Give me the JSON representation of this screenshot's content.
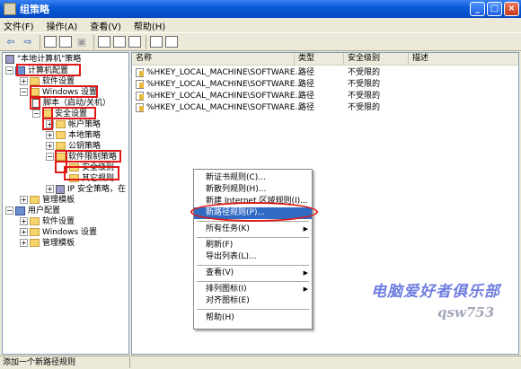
{
  "window": {
    "title": "组策略",
    "minimize": "_",
    "maximize": "□",
    "close": "×"
  },
  "menu": [
    "文件(F)",
    "操作(A)",
    "查看(V)",
    "帮助(H)"
  ],
  "tree": {
    "root": "\"本地计算机\"策略",
    "computer_config": "计算机配置",
    "software_settings": "软件设置",
    "windows_settings": "Windows 设置",
    "scripts": "脚本（启动/关机）",
    "security_settings": "安全设置",
    "account_policies": "帐户策略",
    "local_policies": "本地策略",
    "public_key_policies": "公钥策略",
    "software_restriction": "软件限制策略",
    "security_levels": "安全级别",
    "other_rules": "其它规则",
    "ip_security": "IP 安全策略，在",
    "admin_templates": "管理模板",
    "user_config": "用户配置",
    "user_software_settings": "软件设置",
    "user_windows_settings": "Windows 设置",
    "user_admin_templates": "管理模板"
  },
  "list": {
    "columns": [
      "名称",
      "类型",
      "安全级别",
      "描述"
    ],
    "rows": [
      {
        "name": "%HKEY_LOCAL_MACHINE\\SOFTWARE...",
        "type": "路径",
        "level": "不受限的"
      },
      {
        "name": "%HKEY_LOCAL_MACHINE\\SOFTWARE...",
        "type": "路径",
        "level": "不受限的"
      },
      {
        "name": "%HKEY_LOCAL_MACHINE\\SOFTWARE...",
        "type": "路径",
        "level": "不受限的"
      },
      {
        "name": "%HKEY_LOCAL_MACHINE\\SOFTWARE...",
        "type": "路径",
        "level": "不受限的"
      }
    ]
  },
  "context_menu": {
    "new_cert_rule": "新证书规则(C)...",
    "new_hash_rule": "新散列规则(H)...",
    "new_internet_zone_rule": "新建 Internet 区域规则(I)...",
    "new_path_rule": "新路径规则(P)...",
    "all_tasks": "所有任务(K)",
    "refresh": "刷新(F)",
    "export_list": "导出列表(L)...",
    "view": "查看(V)",
    "arrange_icons": "排列图标(I)",
    "line_up_icons": "对齐图标(E)",
    "help": "帮助(H)"
  },
  "watermark": {
    "line1": "电脑爱好者俱乐部",
    "line2": "qsw753"
  },
  "status": "添加一个新路径规则"
}
